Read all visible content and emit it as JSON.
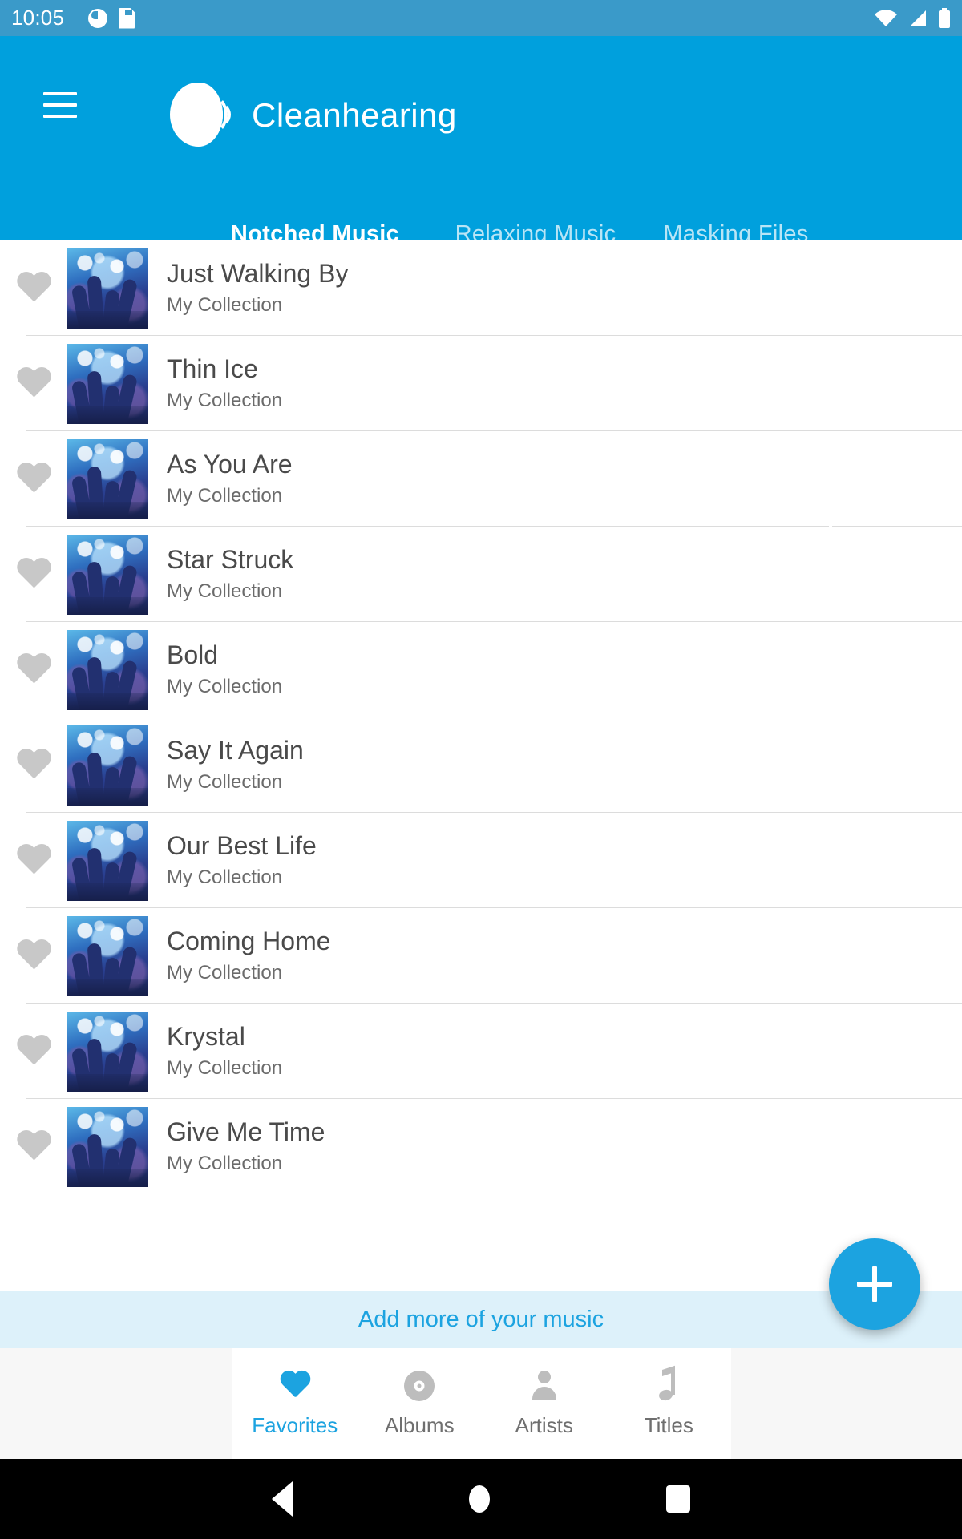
{
  "status_bar": {
    "time": "10:05",
    "icons": [
      "clock-circle-icon",
      "sd-card-icon",
      "wifi-icon",
      "signal-icon",
      "battery-icon"
    ]
  },
  "app_bar": {
    "menu_icon": "hamburger-menu-icon",
    "logo_icon": "cleanhearing-ear-logo-icon",
    "brand": "Cleanhearing",
    "background_color": "#00a0dd"
  },
  "tabs": [
    {
      "label": "Notched Music",
      "active": true
    },
    {
      "label": "Relaxing Music",
      "active": false
    },
    {
      "label": "Masking Files",
      "active": false
    }
  ],
  "songs": [
    {
      "title": "Just Walking By",
      "subtitle": "My Collection",
      "favorite_icon": "heart-outline-icon"
    },
    {
      "title": "Thin Ice",
      "subtitle": "My Collection",
      "favorite_icon": "heart-outline-icon"
    },
    {
      "title": "As You Are",
      "subtitle": "My Collection",
      "favorite_icon": "heart-outline-icon"
    },
    {
      "title": "Star Struck",
      "subtitle": "My Collection",
      "favorite_icon": "heart-outline-icon"
    },
    {
      "title": "Bold",
      "subtitle": "My Collection",
      "favorite_icon": "heart-outline-icon"
    },
    {
      "title": "Say It Again",
      "subtitle": "My Collection",
      "favorite_icon": "heart-outline-icon"
    },
    {
      "title": "Our Best Life",
      "subtitle": "My Collection",
      "favorite_icon": "heart-outline-icon"
    },
    {
      "title": "Coming Home",
      "subtitle": "My Collection",
      "favorite_icon": "heart-outline-icon"
    },
    {
      "title": "Krystal",
      "subtitle": "My Collection",
      "favorite_icon": "heart-outline-icon"
    },
    {
      "title": "Give Me Time",
      "subtitle": "My Collection",
      "favorite_icon": "heart-outline-icon"
    }
  ],
  "banner": {
    "label": "Add more of your music",
    "text_color": "#1ca3e0",
    "background_color": "#ddf1fa"
  },
  "fab": {
    "icon": "plus-icon",
    "color": "#1ca3e0"
  },
  "bottom_nav": [
    {
      "label": "Favorites",
      "icon": "heart-filled-icon",
      "active": true
    },
    {
      "label": "Albums",
      "icon": "disc-icon",
      "active": false
    },
    {
      "label": "Artists",
      "icon": "person-icon",
      "active": false
    },
    {
      "label": "Titles",
      "icon": "music-note-icon",
      "active": false
    }
  ],
  "android_nav": {
    "back": "back-triangle-icon",
    "home": "home-circle-icon",
    "recents": "recents-square-icon"
  }
}
